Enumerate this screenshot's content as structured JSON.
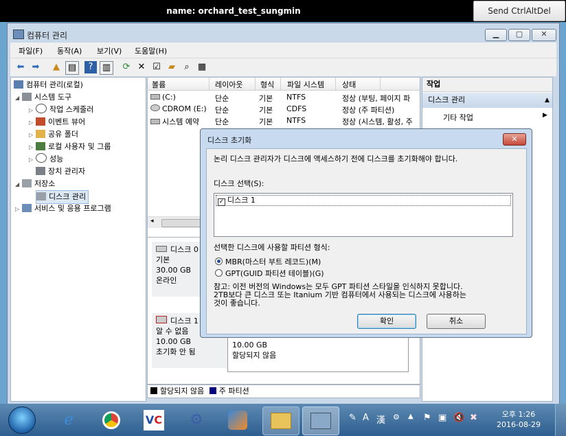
{
  "vnc": {
    "title": "name: orchard_test_sungmin",
    "send_button": "Send CtrlAltDel"
  },
  "window": {
    "title": "컴퓨터 관리",
    "menu": [
      "파일(F)",
      "동작(A)",
      "보기(V)",
      "도움말(H)"
    ]
  },
  "tree": {
    "root": "컴퓨터 관리(로컬)",
    "items": [
      {
        "label": "시스템 도구"
      },
      {
        "label": "작업 스케줄러"
      },
      {
        "label": "이벤트 뷰어"
      },
      {
        "label": "공유 폴더"
      },
      {
        "label": "로컬 사용자 및 그룹"
      },
      {
        "label": "성능"
      },
      {
        "label": "장치 관리자"
      },
      {
        "label": "저장소"
      },
      {
        "label": "디스크 관리"
      },
      {
        "label": "서비스 및 응용 프로그램"
      }
    ]
  },
  "volumes": {
    "headers": [
      "볼륨",
      "레이아웃",
      "형식",
      "파일 시스템",
      "상태"
    ],
    "rows": [
      [
        "(C:)",
        "단순",
        "기본",
        "NTFS",
        "정상 (부팅, 페이지 파"
      ],
      [
        "CDROM (E:)",
        "단순",
        "기본",
        "CDFS",
        "정상 (주 파티션)"
      ],
      [
        "시스템 예약",
        "단순",
        "기본",
        "NTFS",
        "정상 (시스템, 활성, 주"
      ]
    ]
  },
  "disks": {
    "disk0": {
      "name": "디스크 0",
      "type": "기본",
      "size": "30.00 GB",
      "status": "온라인"
    },
    "disk1": {
      "name": "디스크 1",
      "type": "알 수 없음",
      "size": "10.00 GB",
      "status": "초기화 안 됨",
      "part_size": "10.00 GB",
      "part_state": "할당되지 않음"
    }
  },
  "legend": {
    "unallocated": "할당되지 않음",
    "primary": "주 파티션",
    "colors": {
      "unallocated": "#000000",
      "primary": "#000080"
    }
  },
  "actions": {
    "header": "작업",
    "section": "디스크 관리",
    "more": "기타 작업"
  },
  "dialog": {
    "title": "디스크 초기화",
    "message": "논리 디스크 관리자가 디스크에 액세스하기 전에 디스크를 초기화해야 합니다.",
    "select_label": "디스크 선택(S):",
    "disk_item": "디스크 1",
    "style_label": "선택한 디스크에 사용할 파티션 형식:",
    "mbr": "MBR(마스터 부트 레코드)(M)",
    "gpt": "GPT(GUID 파티션 테이블)(G)",
    "note_line1": "참고: 이전 버전의 Windows는 모두 GPT 파티션 스타일을 인식하지 못합니다.",
    "note_line2": "2TB보다 큰 디스크 또는 Itanium 기반 컴퓨터에서 사용되는 디스크에 사용하는",
    "note_line3": "것이 좋습니다.",
    "ok": "확인",
    "cancel": "취소"
  },
  "tray": {
    "ime_a": "A",
    "ime_han": "漢",
    "time": "오후 1:26",
    "date": "2016-08-29"
  }
}
